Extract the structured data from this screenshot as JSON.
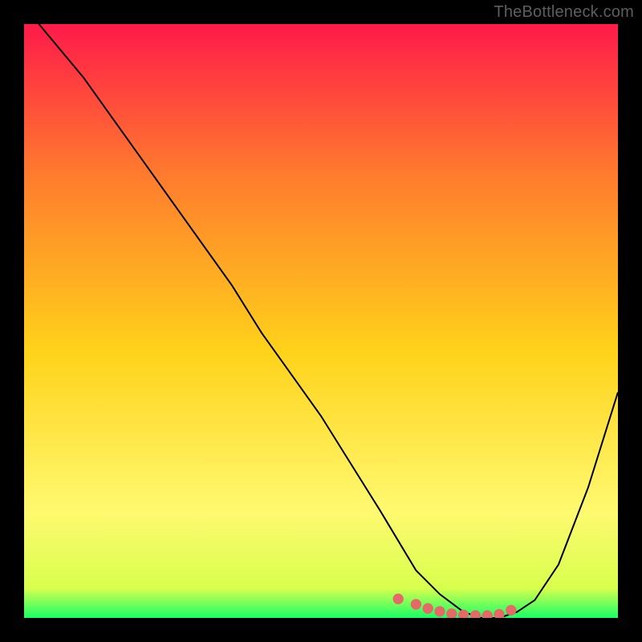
{
  "watermark": "TheBottleneck.com",
  "colors": {
    "bg_black": "#000000",
    "watermark": "#5e5e5e",
    "curve": "#000000",
    "marker": "#e46a67",
    "grad_top": "#ff1a4a",
    "grad_mid1": "#ff7a2e",
    "grad_mid2": "#ffd21a",
    "grad_mid3": "#fff970",
    "grad_bottom": "#18ff66"
  },
  "chart_data": {
    "type": "line",
    "title": "",
    "xlabel": "",
    "ylabel": "",
    "xlim": [
      0,
      100
    ],
    "ylim": [
      0,
      100
    ],
    "grid": false,
    "legend": false,
    "series": [
      {
        "name": "bottleneck-curve",
        "x": [
          0,
          5,
          10,
          15,
          20,
          25,
          30,
          35,
          40,
          45,
          50,
          55,
          60,
          63,
          66,
          70,
          74,
          77,
          80,
          83,
          86,
          90,
          95,
          100
        ],
        "y": [
          103,
          97,
          91,
          84,
          77,
          70,
          63,
          56,
          48,
          41,
          34,
          26,
          18,
          13,
          8,
          4,
          1,
          0,
          0,
          1,
          3,
          9,
          22,
          38
        ]
      }
    ],
    "markers": {
      "name": "highlight-band",
      "x": [
        63,
        66,
        68,
        70,
        72,
        74,
        76,
        78,
        80,
        82
      ],
      "y": [
        3.2,
        2.3,
        1.6,
        1.1,
        0.7,
        0.5,
        0.4,
        0.4,
        0.6,
        1.3
      ]
    },
    "gradient_stops": [
      {
        "pct": 0,
        "color": "#ff1a4a"
      },
      {
        "pct": 25,
        "color": "#ff7a2e"
      },
      {
        "pct": 55,
        "color": "#ffd21a"
      },
      {
        "pct": 82,
        "color": "#fff970"
      },
      {
        "pct": 95,
        "color": "#d8ff4d"
      },
      {
        "pct": 100,
        "color": "#18ff66"
      }
    ]
  }
}
